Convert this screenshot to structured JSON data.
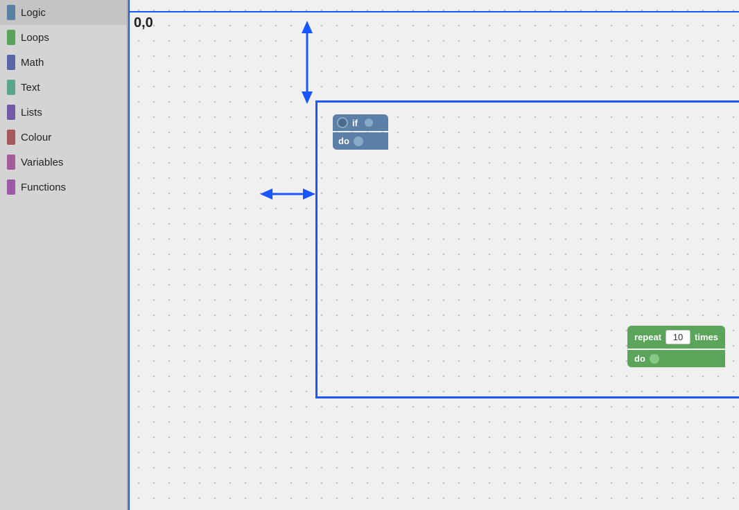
{
  "sidebar": {
    "items": [
      {
        "id": "logic",
        "label": "Logic",
        "color": "#5b80a5"
      },
      {
        "id": "loops",
        "label": "Loops",
        "color": "#5ba55b"
      },
      {
        "id": "math",
        "label": "Math",
        "color": "#5b67a5"
      },
      {
        "id": "text",
        "label": "Text",
        "color": "#5ba58c"
      },
      {
        "id": "lists",
        "label": "Lists",
        "color": "#745ba5"
      },
      {
        "id": "colour",
        "label": "Colour",
        "color": "#a55b5b"
      },
      {
        "id": "variables",
        "label": "Variables",
        "color": "#a55b99"
      },
      {
        "id": "functions",
        "label": "Functions",
        "color": "#9b5ba5"
      }
    ]
  },
  "canvas": {
    "coords_label": "0,0",
    "selection_border_color": "#1a56ff",
    "crosshair_color": "#1a56ff"
  },
  "blocks": {
    "if_block": {
      "if_label": "if",
      "do_label": "do"
    },
    "repeat_block": {
      "repeat_label": "repeat",
      "times_value": "10",
      "times_label": "times",
      "do_label": "do"
    }
  }
}
